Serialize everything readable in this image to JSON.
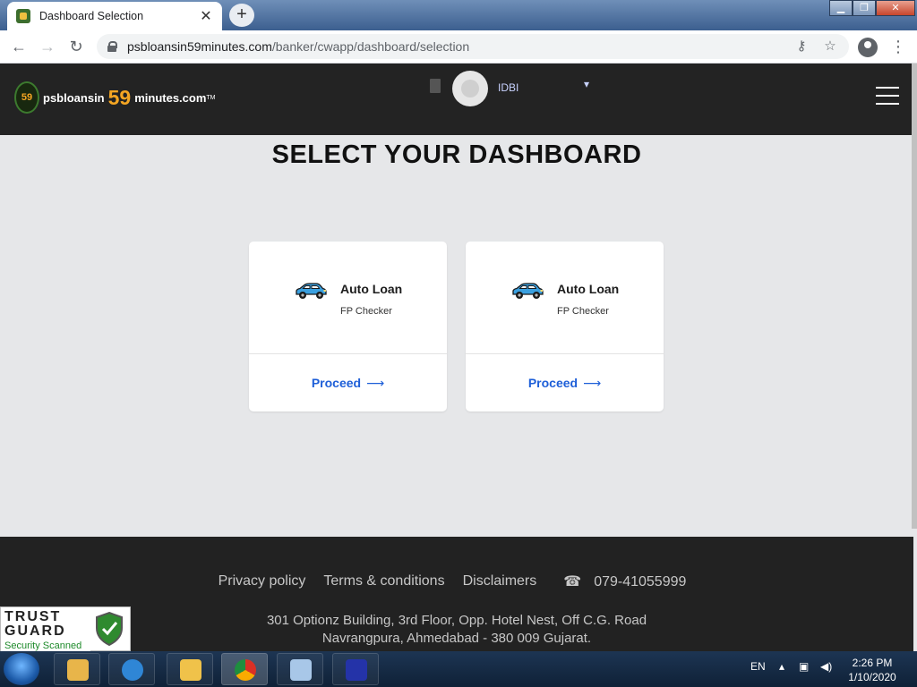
{
  "browser": {
    "tab_title": "Dashboard Selection",
    "new_tab_label": "+",
    "url_domain": "psbloansin59minutes.com",
    "url_path": "/banker/cwapp/dashboard/selection"
  },
  "header": {
    "logo_badge": "59",
    "logo_text_a": "psbloansin",
    "logo_text_59": "59",
    "logo_text_b": "minutes.com",
    "logo_tm": "TM",
    "bank_name": "IDBI"
  },
  "main": {
    "title": "SELECT YOUR DASHBOARD",
    "cards": [
      {
        "name": "Auto Loan",
        "role": "FP Checker",
        "action": "Proceed"
      },
      {
        "name": "Auto Loan",
        "role": "FP Checker",
        "action": "Proceed"
      }
    ]
  },
  "footer": {
    "links": [
      "Privacy policy",
      "Terms & conditions",
      "Disclaimers"
    ],
    "phone": "079-41055999",
    "address_line1": "301 Optionz Building, 3rd Floor, Opp. Hotel Nest, Off C.G. Road",
    "address_line2": "Navrangpura, Ahmedabad - 380 009 Gujarat."
  },
  "trust_badge": {
    "line1": "TRUST",
    "line2": "GUARD",
    "line3": "Security Scanned"
  },
  "taskbar": {
    "lang": "EN",
    "time": "2:26 PM",
    "date": "1/10/2020"
  },
  "colors": {
    "accent_blue": "#1e5fd8",
    "brand_orange": "#f5a623",
    "header_bg": "#232323"
  }
}
